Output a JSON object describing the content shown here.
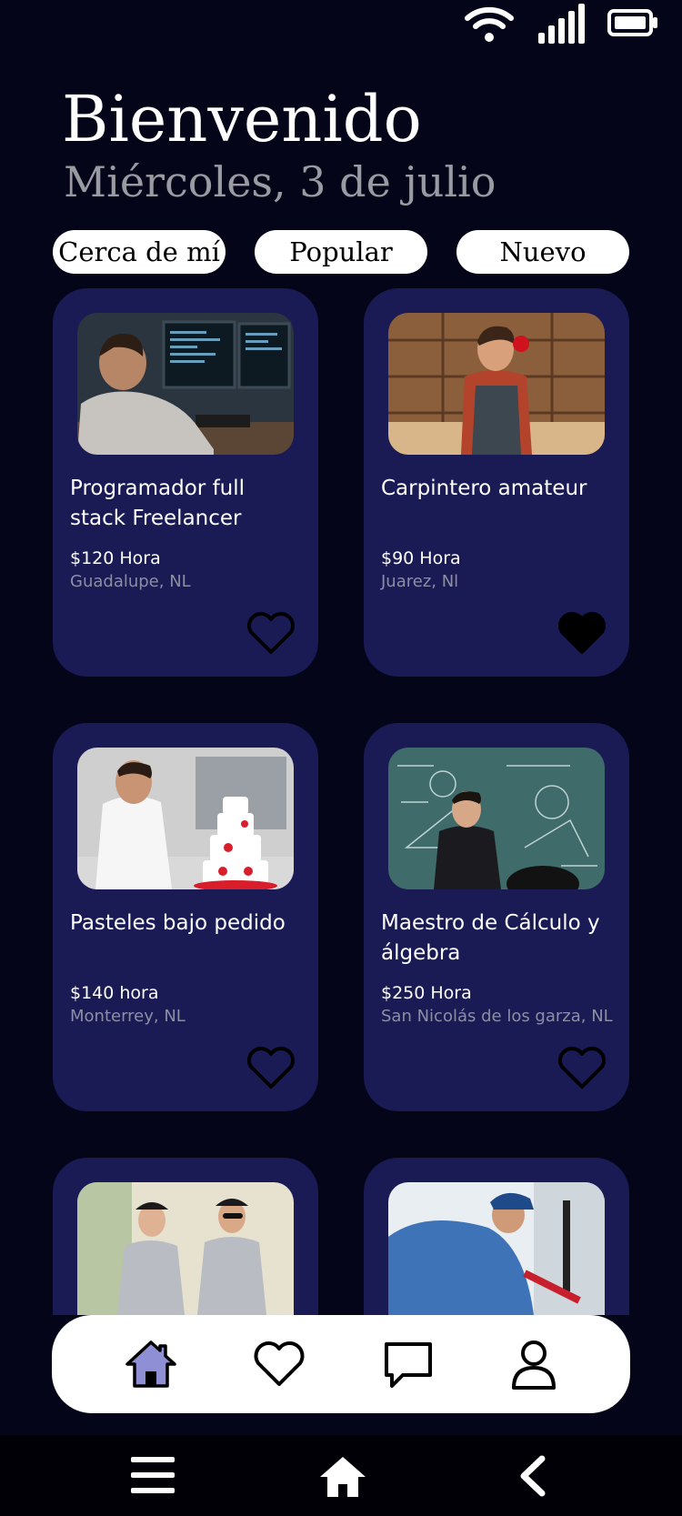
{
  "header": {
    "greeting": "Bienvenido",
    "date": "Miércoles, 3 de julio"
  },
  "filters": [
    {
      "label": "Cerca de mí"
    },
    {
      "label": "Popular"
    },
    {
      "label": "Nuevo"
    }
  ],
  "cards": [
    {
      "title": "Programador full stack Freelancer",
      "price": "$120 Hora",
      "location": "Guadalupe, NL",
      "favorite": false,
      "icon": "heart-outline-icon"
    },
    {
      "title": "Carpintero amateur",
      "price": "$90 Hora",
      "location": "Juarez, Nl",
      "favorite": true,
      "icon": "heart-filled-icon"
    },
    {
      "title": "Pasteles bajo pedido",
      "price": "$140 hora",
      "location": "Monterrey, NL",
      "favorite": false,
      "icon": "heart-outline-icon"
    },
    {
      "title": "Maestro de Cálculo y álgebra",
      "price": "$250 Hora",
      "location": "San Nicolás de los garza, NL",
      "favorite": false,
      "icon": "heart-outline-icon"
    }
  ],
  "bottom_nav": [
    {
      "name": "home-icon",
      "active": true
    },
    {
      "name": "heart-icon",
      "active": false
    },
    {
      "name": "chat-icon",
      "active": false
    },
    {
      "name": "profile-icon",
      "active": false
    }
  ],
  "system_nav": [
    "menu-icon",
    "home-icon",
    "back-icon"
  ],
  "colors": {
    "background": "#05051a",
    "card": "#1a1a55",
    "active_tab": "#8f8fd6",
    "secondary_text": "#9a9aa2"
  }
}
